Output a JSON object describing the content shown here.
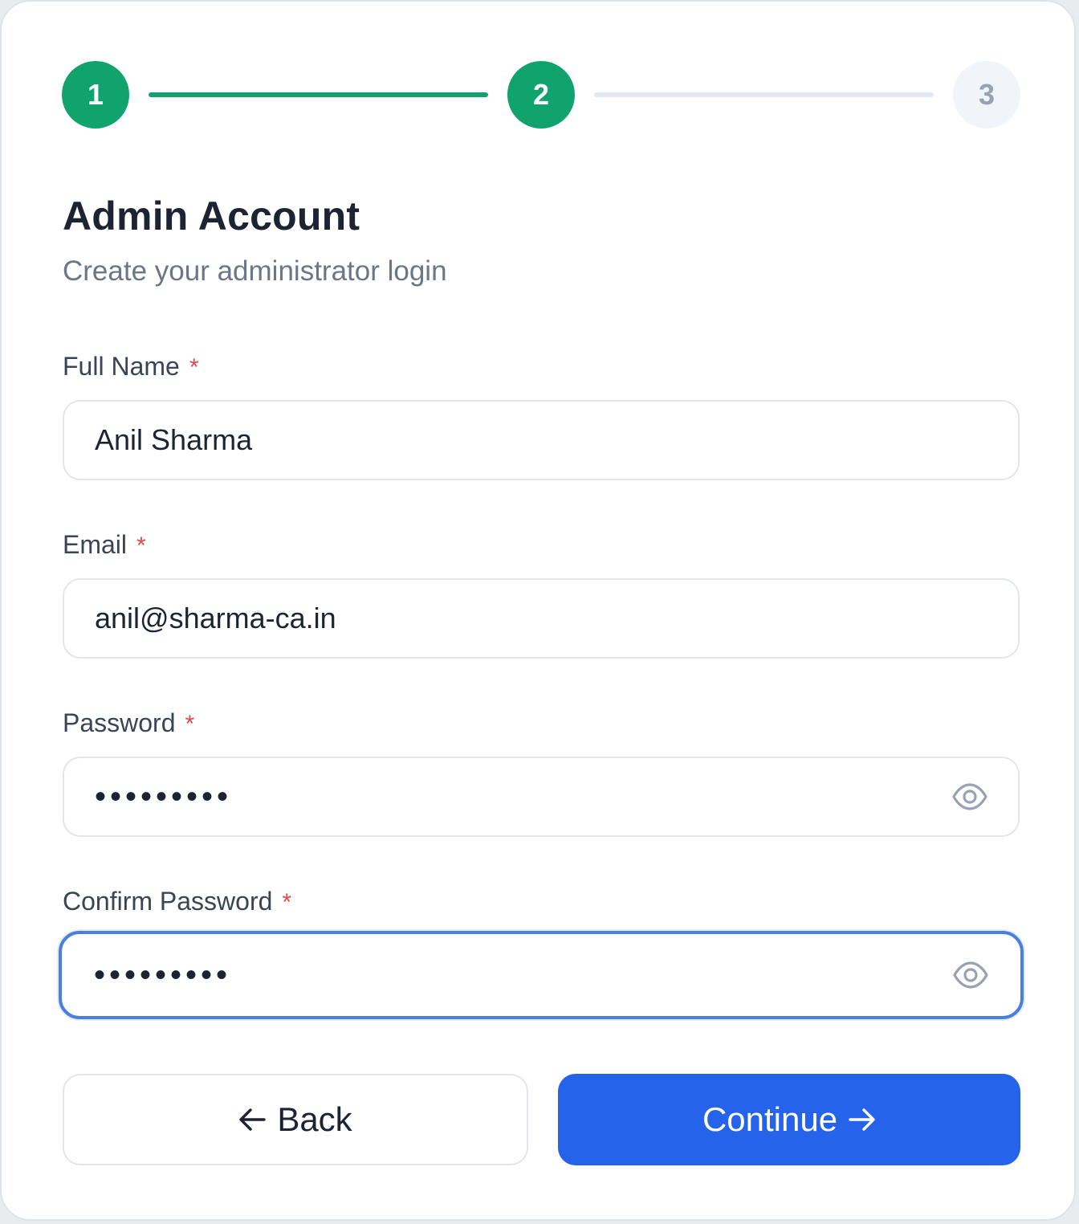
{
  "stepper": {
    "steps": [
      {
        "label": "1",
        "state": "done"
      },
      {
        "label": "2",
        "state": "current"
      },
      {
        "label": "3",
        "state": "todo"
      }
    ],
    "accent_color": "#10a36e"
  },
  "header": {
    "title": "Admin Account",
    "subtitle": "Create your administrator login"
  },
  "form": {
    "full_name": {
      "label": "Full Name",
      "required_mark": "*",
      "value": "Anil Sharma"
    },
    "email": {
      "label": "Email",
      "required_mark": "*",
      "value": "anil@sharma-ca.in"
    },
    "password": {
      "label": "Password",
      "required_mark": "*",
      "masked_value": "•••••••••",
      "toggle_icon": "eye-icon"
    },
    "confirm_password": {
      "label": "Confirm Password",
      "required_mark": "*",
      "masked_value": "•••••••••",
      "toggle_icon": "eye-icon",
      "focused": true
    }
  },
  "actions": {
    "back_label": "Back",
    "continue_label": "Continue",
    "primary_color": "#2563eb"
  }
}
